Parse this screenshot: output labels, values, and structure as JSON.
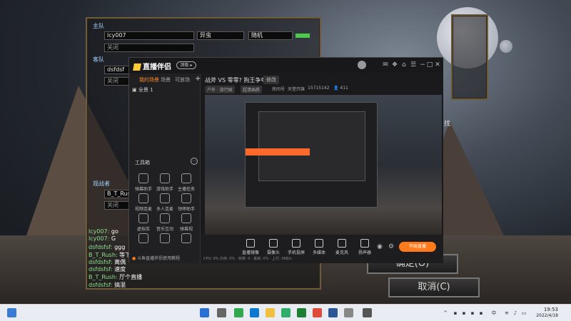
{
  "game": {
    "team1_label": "主队",
    "team1_slots": [
      "lcy007",
      "关闭"
    ],
    "race": "异虫",
    "position": "随机",
    "team2_label": "客队",
    "team2_slots": [
      "dsfdsf",
      "关闭"
    ],
    "observer_label": "观战者",
    "observer_slots": [
      "B_T_Rus",
      "关闭"
    ],
    "chat": [
      {
        "name": "lcy007",
        "msg": "go"
      },
      {
        "name": "lcy007",
        "msg": "G"
      },
      {
        "name": "dsfdsfsf",
        "msg": "ggg"
      },
      {
        "name": "B_T_Rush",
        "msg": "等下"
      },
      {
        "name": "dsfdsfsf",
        "msg": "离偶"
      },
      {
        "name": "dsfdsfsf",
        "msg": "速度"
      },
      {
        "name": "B_T_Rush",
        "msg": "厅个直播"
      },
      {
        "name": "dsfdsfsf",
        "msg": "搞混"
      }
    ],
    "ok_button": "确定(O)",
    "cancel_button": "取消(C)",
    "side_char": "找"
  },
  "app": {
    "logo": "直播伴侣",
    "badge": "测版 ▸",
    "left_tabs": [
      "我的场景",
      "场景",
      "可放场"
    ],
    "scene_name": "全景 1",
    "toolbox_label": "工具箱",
    "tools": [
      "弹幕助手",
      "游戏助手",
      "主播任务",
      "视频连麦",
      "多人连麦",
      "领停助手",
      "虚拟库",
      "音乐互动",
      "弹幕视",
      "",
      "",
      ""
    ],
    "bottom_tip": "斗鱼直播伴侣使用教程",
    "stream_title": "战斧 VS 零零? 狗王争夺之战",
    "edit_label": "修改",
    "meta": {
      "category": "户外 · 旅行娱",
      "quality": "超清画质",
      "room_label": "房间号",
      "room_id": "天堂开旗",
      "room_num": "15715142",
      "viewers": "411"
    },
    "bottom_buttons": [
      "直播镜像",
      "摄像头",
      "手机投屏",
      "多媒体",
      "麦克风",
      "扬声器"
    ],
    "live_button": "开始直播",
    "status": "CPU: 0%   内存: 0%   ·   帧率: 0   ·   丢帧: 0%   ·   上行: 0KB/s"
  },
  "taskbar": {
    "time": "19:53",
    "date": "2022/4/18"
  }
}
